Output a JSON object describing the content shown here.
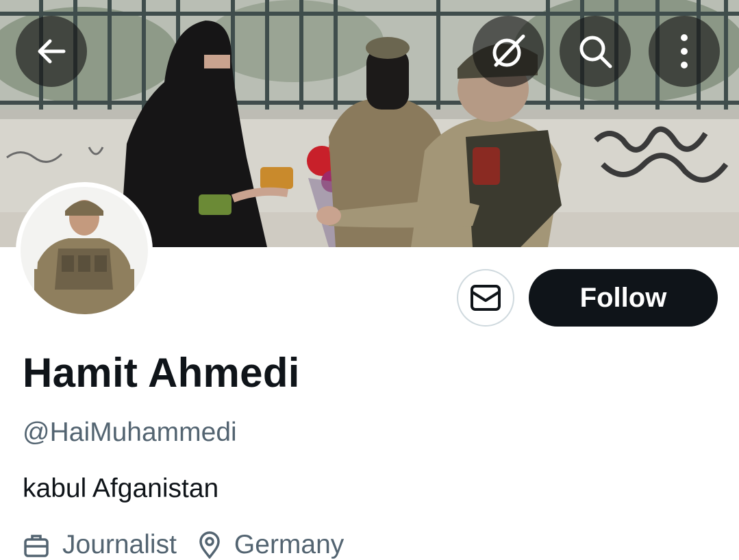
{
  "header": {
    "back_icon": "arrow-left-icon",
    "grok_icon": "grok-icon",
    "search_icon": "search-icon",
    "more_icon": "more-vertical-icon"
  },
  "profile": {
    "name": "Hamit Ahmedi",
    "handle": "@HaiMuhammedi",
    "bio": "kabul Afganistan",
    "profession": "Journalist",
    "location": "Germany"
  },
  "actions": {
    "message_icon": "envelope-icon",
    "follow_label": "Follow"
  },
  "colors": {
    "follow_bg": "#0f1419",
    "secondary_text": "#536471",
    "border": "#cfd9de"
  }
}
